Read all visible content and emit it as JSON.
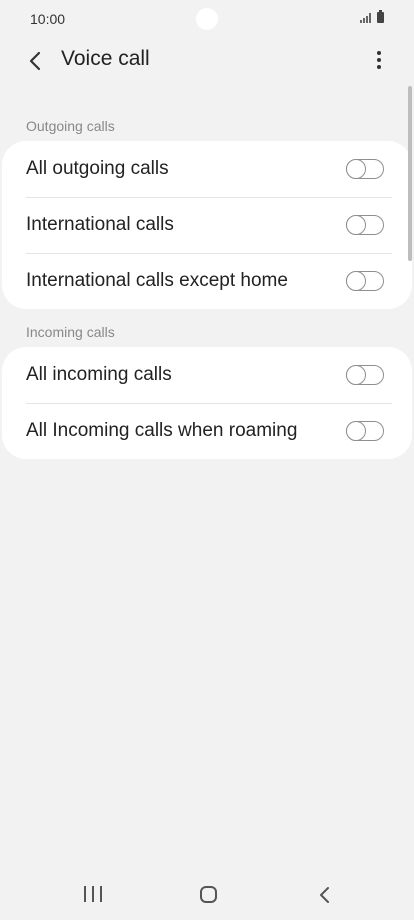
{
  "status_bar": {
    "time": "10:00"
  },
  "app_bar": {
    "title": "Voice call",
    "back_icon": "chevron-left-icon",
    "menu_icon": "more-vertical-icon"
  },
  "sections": [
    {
      "header": "Outgoing calls",
      "items": [
        {
          "label": "All outgoing calls",
          "enabled": false
        },
        {
          "label": "International calls",
          "enabled": false
        },
        {
          "label": "International calls except home",
          "enabled": false
        }
      ]
    },
    {
      "header": "Incoming calls",
      "items": [
        {
          "label": "All incoming calls",
          "enabled": false
        },
        {
          "label": "All Incoming calls when roaming",
          "enabled": false
        }
      ]
    }
  ],
  "nav_bar": {
    "recents_icon": "recents-icon",
    "home_icon": "home-icon",
    "back_icon": "back-icon"
  },
  "colors": {
    "background": "#f2f2f2",
    "card": "#ffffff",
    "toggle_off": "#8f8f8f",
    "section_header": "#888888"
  }
}
